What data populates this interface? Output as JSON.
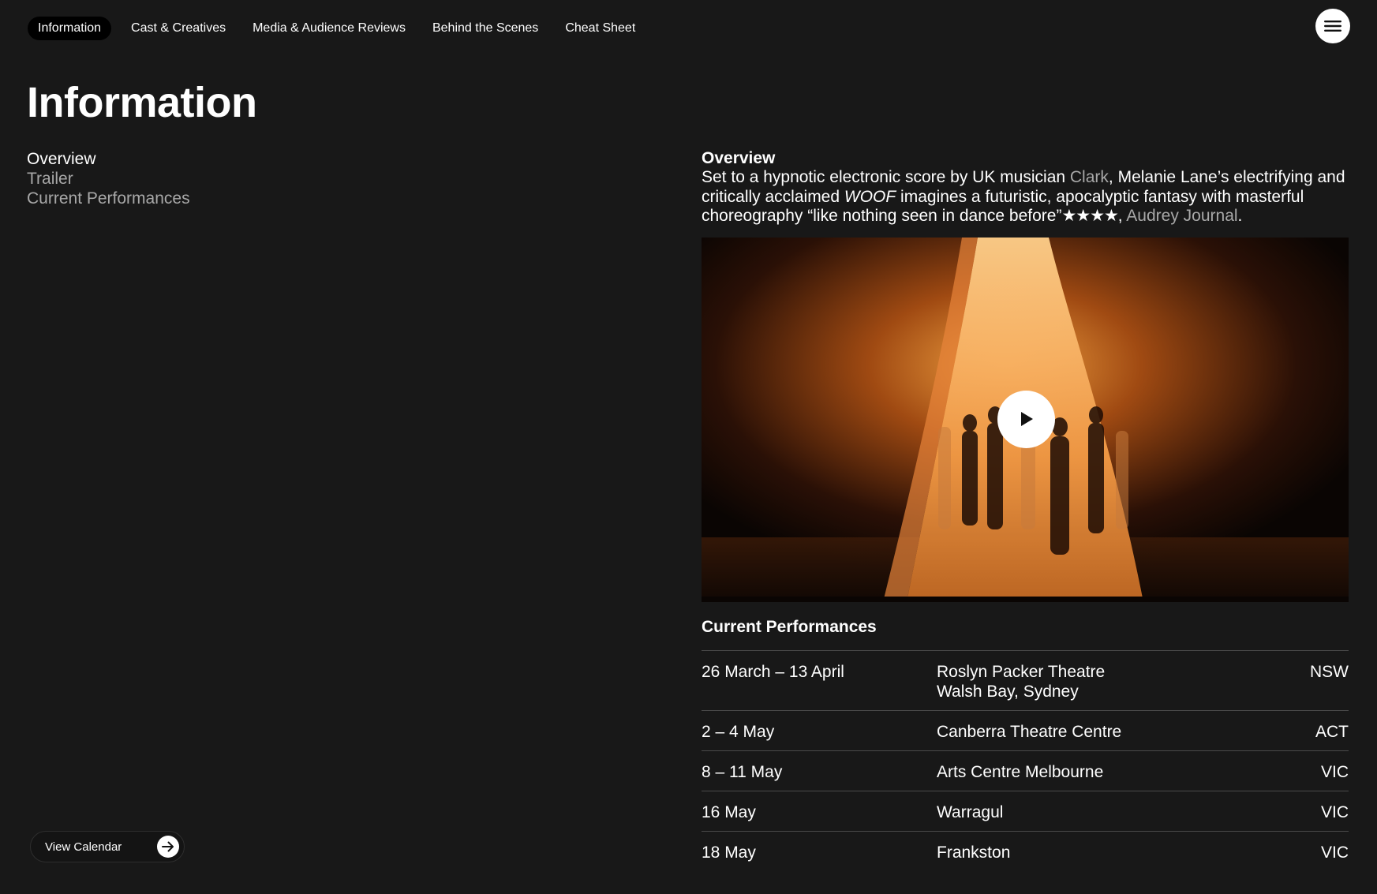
{
  "nav": {
    "tabs": [
      {
        "label": "Information",
        "active": true
      },
      {
        "label": "Cast & Creatives",
        "active": false
      },
      {
        "label": "Media & Audience Reviews",
        "active": false
      },
      {
        "label": "Behind the Scenes",
        "active": false
      },
      {
        "label": "Cheat Sheet",
        "active": false
      }
    ],
    "menu_icon": "hamburger-menu-icon"
  },
  "page": {
    "title": "Information"
  },
  "subnav": {
    "items": [
      {
        "label": "Overview",
        "active": true
      },
      {
        "label": "Trailer",
        "active": false
      },
      {
        "label": "Current Performances",
        "active": false
      }
    ]
  },
  "calendar_button": {
    "label": "View Calendar",
    "icon": "arrow-right-icon"
  },
  "overview": {
    "heading": "Overview",
    "text_1": "Set to a hypnotic electronic score by UK musician ",
    "link_clark": "Clark",
    "text_2": ", Melanie Lane’s electrifying and critically acclaimed ",
    "title_italic": "WOOF",
    "text_3": " imagines a futuristic, apocalyptic fantasy with masterful choreography “like nothing seen in dance before”",
    "stars": "★★★★",
    "text_4": ", ",
    "link_source": "Audrey Journal",
    "text_5": "."
  },
  "video": {
    "play_icon": "play-icon"
  },
  "performances": {
    "heading": "Current Performances",
    "rows": [
      {
        "date": "26 March – 13 April",
        "venue_line1": "Roslyn Packer Theatre",
        "venue_line2": "Walsh Bay, Sydney",
        "state": "NSW"
      },
      {
        "date": "2 – 4 May",
        "venue_line1": "Canberra Theatre Centre",
        "venue_line2": "",
        "state": "ACT"
      },
      {
        "date": "8 – 11 May",
        "venue_line1": "Arts Centre Melbourne",
        "venue_line2": "",
        "state": "VIC"
      },
      {
        "date": "16 May",
        "venue_line1": "Warragul",
        "venue_line2": "",
        "state": "VIC"
      },
      {
        "date": "18 May",
        "venue_line1": "Frankston",
        "venue_line2": "",
        "state": "VIC"
      }
    ]
  },
  "colors": {
    "background": "#181818",
    "text": "#ffffff",
    "muted": "#a8a8a8",
    "divider": "#4a4a4a"
  }
}
